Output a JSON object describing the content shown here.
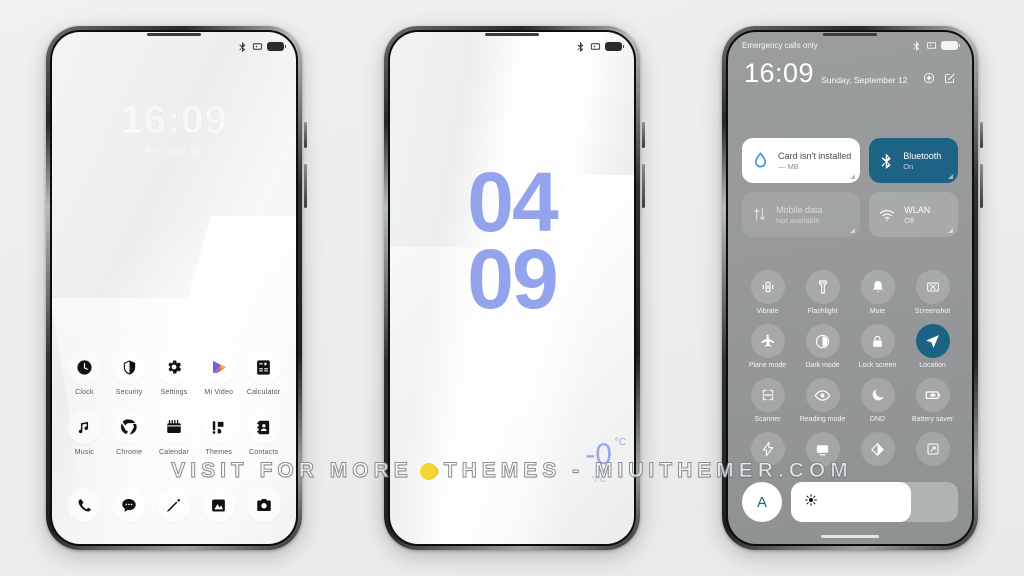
{
  "meta": {
    "background_color": "#eeeeee",
    "accent_blue": "#93a4ec",
    "tile_active_blue": "#1c6385",
    "watermark_yellow": "#f6d633"
  },
  "watermark": {
    "left_text": "VISIT FOR MORE",
    "right_text": "THEMES - MIUITHEMER.COM",
    "logo": "yellow-drop-logo"
  },
  "phone1": {
    "name": "home-screen-preview",
    "statusbar": {
      "bluetooth_icon": "bluetooth-icon",
      "mute_icon": "mute-icon",
      "battery_icon": "battery-icon"
    },
    "lockscreen": {
      "time": "16:09",
      "subtitle": "Fri, Sep 10"
    },
    "apps_row1": [
      {
        "label": "Clock",
        "icon": "clock-icon"
      },
      {
        "label": "Security",
        "icon": "shield-icon"
      },
      {
        "label": "Settings",
        "icon": "gear-icon"
      },
      {
        "label": "Mi Video",
        "icon": "play-icon"
      },
      {
        "label": "Calculator",
        "icon": "calculator-icon"
      }
    ],
    "apps_row2": [
      {
        "label": "Music",
        "icon": "music-note-icon"
      },
      {
        "label": "Chrome",
        "icon": "chrome-icon"
      },
      {
        "label": "Calendar",
        "icon": "calendar-icon"
      },
      {
        "label": "Themes",
        "icon": "themes-icon"
      },
      {
        "label": "Contacts",
        "icon": "contacts-icon"
      }
    ],
    "dock": [
      {
        "label": "Phone",
        "icon": "phone-icon"
      },
      {
        "label": "Messages",
        "icon": "message-icon"
      },
      {
        "label": "Notes",
        "icon": "pencil-icon"
      },
      {
        "label": "Gallery",
        "icon": "gallery-icon"
      },
      {
        "label": "Camera",
        "icon": "camera-icon"
      }
    ]
  },
  "phone2": {
    "name": "lockscreen-clock-preview",
    "statusbar": {
      "bluetooth_icon": "bluetooth-icon",
      "mute_icon": "mute-icon",
      "battery_icon": "battery-icon"
    },
    "clock": {
      "hours": "04",
      "minutes": "09"
    },
    "weather": {
      "temperature": "-0",
      "unit": "°C",
      "range": "°/°C"
    }
  },
  "phone3": {
    "name": "control-center-preview",
    "statusbar": {
      "carrier": "Emergency calls only",
      "bluetooth_icon": "bluetooth-icon",
      "mute_icon": "mute-icon",
      "battery_icon": "battery-icon"
    },
    "header": {
      "time": "16:09",
      "date": "Sunday, September 12",
      "settings_icon": "settings-gear-icon",
      "edit_icon": "edit-icon"
    },
    "big_tiles": [
      {
        "title": "Card isn't installed",
        "sub": "— MB",
        "icon": "water-drop-icon",
        "state": "white"
      },
      {
        "title": "Bluetooth",
        "sub": "On",
        "icon": "bluetooth-icon",
        "state": "blue"
      },
      {
        "title": "Mobile data",
        "sub": "Not available",
        "icon": "data-arrows-icon",
        "state": "dim"
      },
      {
        "title": "WLAN",
        "sub": "Off",
        "icon": "wifi-icon",
        "state": "default"
      }
    ],
    "toggles": [
      {
        "label": "Vibrate",
        "icon": "vibrate-icon",
        "active": false
      },
      {
        "label": "Flashlight",
        "icon": "flashlight-icon",
        "active": false
      },
      {
        "label": "Mute",
        "icon": "bell-icon",
        "active": false
      },
      {
        "label": "Screenshot",
        "icon": "screenshot-icon",
        "active": false
      },
      {
        "label": "Plane mode",
        "icon": "airplane-icon",
        "active": false
      },
      {
        "label": "Dark mode",
        "icon": "contrast-circle-icon",
        "active": false
      },
      {
        "label": "Lock screen",
        "icon": "lock-icon",
        "active": false
      },
      {
        "label": "Location",
        "icon": "location-arrow-icon",
        "active": true
      },
      {
        "label": "Scanner",
        "icon": "scanner-icon",
        "active": false
      },
      {
        "label": "Reading mode",
        "icon": "eye-icon",
        "active": false
      },
      {
        "label": "DND",
        "icon": "moon-icon",
        "active": false
      },
      {
        "label": "Battery saver",
        "icon": "battery-saver-icon",
        "active": false
      },
      {
        "label": "",
        "icon": "lightning-icon",
        "active": false
      },
      {
        "label": "",
        "icon": "cast-screen-icon",
        "active": false
      },
      {
        "label": "",
        "icon": "contrast-icon",
        "active": false
      },
      {
        "label": "",
        "icon": "resize-icon",
        "active": false
      }
    ],
    "brightness": {
      "auto_label": "A",
      "icon": "brightness-sun-icon",
      "value_percent": 72
    }
  }
}
